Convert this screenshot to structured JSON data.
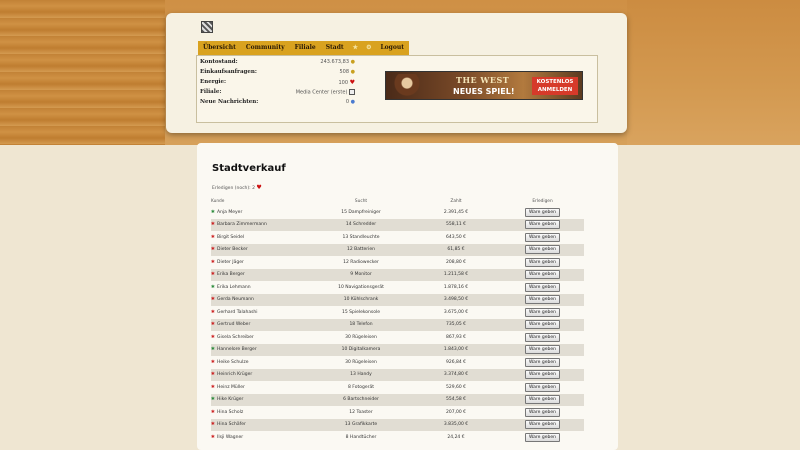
{
  "nav": {
    "items": [
      {
        "label": "Übersicht"
      },
      {
        "label": "Community"
      },
      {
        "label": "Filiale"
      },
      {
        "label": "Stadt"
      }
    ],
    "logout_label": "Logout"
  },
  "info": {
    "kontostand_label": "Kontostand:",
    "kontostand_value": "243.673,83",
    "einkauf_label": "Einkaufsanfragen:",
    "einkauf_value": "508",
    "energie_label": "Energie:",
    "energie_value": "100",
    "filiale_label": "Filiale:",
    "filiale_value": "Media Center (erste)",
    "nachrichten_label": "Neue Nachrichten:",
    "nachrichten_value": "0"
  },
  "banner": {
    "title": "THE WEST",
    "subtitle": "NEUES SPIEL!",
    "badge": "KOSTENLOS ANMELDEN"
  },
  "main": {
    "title": "Stadtverkauf",
    "remaining": "Erledigen (noch): 2",
    "columns": [
      "Kunde",
      "Sucht",
      "Zahlt",
      "Erledigen"
    ],
    "button_label": "Ware geben",
    "rows": [
      {
        "name": "Anja Meyer",
        "icon": "green",
        "seeks": "15 Dampfreiniger",
        "pays": "2.391,45 €"
      },
      {
        "name": "Barbara Zimmermann",
        "icon": "red",
        "seeks": "14 Schredder",
        "pays": "558,11 €"
      },
      {
        "name": "Birgit Seidel",
        "icon": "red",
        "seeks": "13 Standleuchte",
        "pays": "643,50 €"
      },
      {
        "name": "Dieter Becker",
        "icon": "red",
        "seeks": "12 Batterien",
        "pays": "61,85 €"
      },
      {
        "name": "Dieter Jäger",
        "icon": "red",
        "seeks": "12 Radiowecker",
        "pays": "208,80 €"
      },
      {
        "name": "Erika Berger",
        "icon": "red",
        "seeks": "9 Monitor",
        "pays": "1.211,58 €"
      },
      {
        "name": "Erika Lehmann",
        "icon": "green",
        "seeks": "10 Navigationsgerät",
        "pays": "1.878,16 €"
      },
      {
        "name": "Gerda Neumann",
        "icon": "red",
        "seeks": "10 Kühlschrank",
        "pays": "3.498,50 €"
      },
      {
        "name": "Gerhard Talahashi",
        "icon": "red",
        "seeks": "15 Spielekonsole",
        "pays": "3.675,00 €"
      },
      {
        "name": "Gertrud Weber",
        "icon": "red",
        "seeks": "18 Telefon",
        "pays": "735,05 €"
      },
      {
        "name": "Gisela Schreiber",
        "icon": "red",
        "seeks": "30 Rügeleisen",
        "pays": "867,93 €"
      },
      {
        "name": "Hannelore Berger",
        "icon": "green",
        "seeks": "10 Digitalkamera",
        "pays": "1.843,00 €"
      },
      {
        "name": "Heike Schulze",
        "icon": "red",
        "seeks": "30 Rügeleisen",
        "pays": "926,84 €"
      },
      {
        "name": "Heinrich Krüger",
        "icon": "red",
        "seeks": "13 Handy",
        "pays": "3.374,80 €"
      },
      {
        "name": "Heinz Müller",
        "icon": "red",
        "seeks": "8 Fotogerät",
        "pays": "529,60 €"
      },
      {
        "name": "Hike Krüger",
        "icon": "green",
        "seeks": "6 Bartschneider",
        "pays": "554,58 €"
      },
      {
        "name": "Hina Scholz",
        "icon": "red",
        "seeks": "12 Toaster",
        "pays": "207,00 €"
      },
      {
        "name": "Hina Schäfer",
        "icon": "red",
        "seeks": "13 Grafikkarte",
        "pays": "3.835,00 €"
      },
      {
        "name": "Ilsji Wagner",
        "icon": "red",
        "seeks": "8 Handtücher",
        "pays": "24,24 €"
      }
    ]
  }
}
